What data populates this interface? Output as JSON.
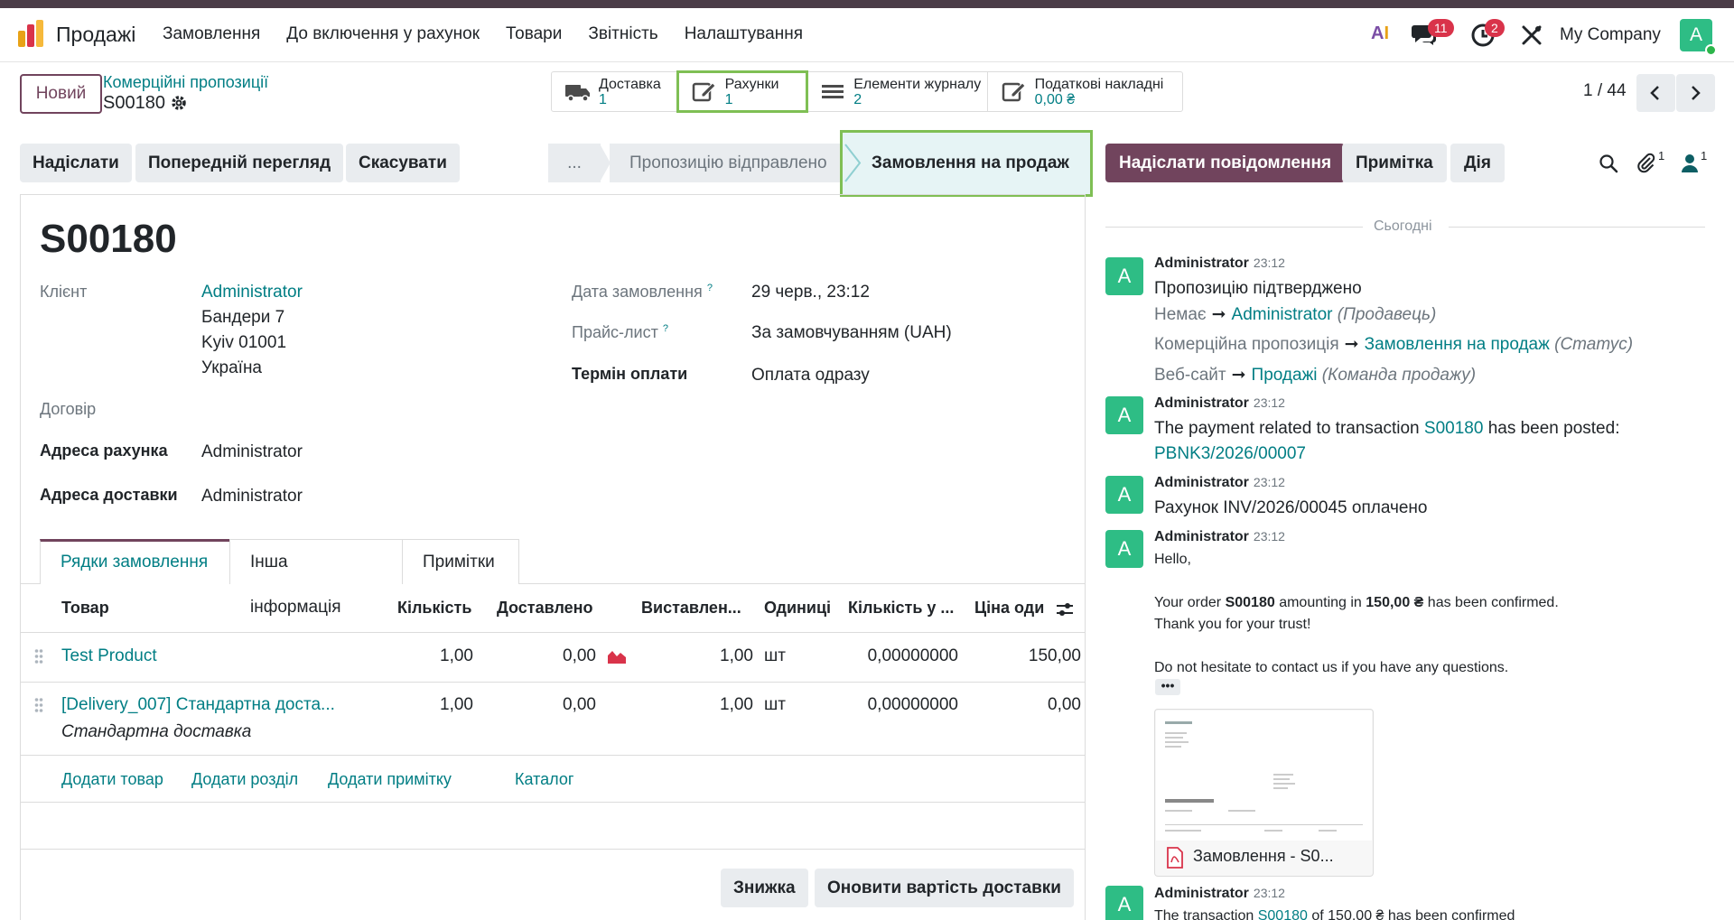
{
  "navbar": {
    "app_name": "Продажі",
    "menu": [
      "Замовлення",
      "До включення у рахунок",
      "Товари",
      "Звітність",
      "Налаштування"
    ],
    "ai_label_a": "A",
    "ai_label_i": "I",
    "messages_badge": "11",
    "activities_badge": "2",
    "company": "My Company",
    "user_initial": "A"
  },
  "control": {
    "new_button": "Новий",
    "breadcrumb_parent": "Комерційні пропозиції",
    "breadcrumb_current": "S00180",
    "smart_buttons": [
      {
        "title": "Доставка",
        "value": "1",
        "icon": "truck-icon"
      },
      {
        "title": "Рахунки",
        "value": "1",
        "icon": "pencil-square-icon"
      },
      {
        "title": "Елементи журналу",
        "value": "2",
        "icon": "list-icon"
      },
      {
        "title": "Податкові накладні",
        "value": "0,00 ₴",
        "icon": "pencil-square-icon"
      }
    ],
    "pager": "1 / 44"
  },
  "statusbar": {
    "buttons": [
      "Надіслати",
      "Попередній перегляд",
      "Скасувати"
    ],
    "stages": [
      "...",
      "Пропозицію відправлено",
      "Замовлення на продаж"
    ],
    "active_stage": "Замовлення на продаж"
  },
  "chatter_bar": {
    "send_message": "Надіслати повідомлення",
    "note": "Примітка",
    "action": "Дія",
    "attachments_count": "1",
    "followers_count": "1"
  },
  "form": {
    "name": "S00180",
    "customer_label": "Клієнт",
    "customer_name": "Administrator",
    "customer_address": [
      "Бандери 7",
      "Kyiv 01001",
      "Україна"
    ],
    "contract_label": "Договір",
    "invoice_address_label": "Адреса рахунка",
    "invoice_address": "Administrator",
    "delivery_address_label": "Адреса доставки",
    "delivery_address": "Administrator",
    "order_date_label": "Дата замовлення",
    "order_date": "29 черв., 23:12",
    "pricelist_label": "Прайс-лист",
    "pricelist": "За замовчуванням (UAH)",
    "payment_terms_label": "Термін оплати",
    "payment_terms": "Оплата одразу",
    "help_mark": "?"
  },
  "tabs": [
    "Рядки замовлення",
    "Інша інформація",
    "Примітки"
  ],
  "lines": {
    "headers": [
      "Товар",
      "Кількість",
      "Доставлено",
      "Виставлен...",
      "Одиниці",
      "Кількість у ...",
      "Ціна оди"
    ],
    "rows": [
      {
        "product": "Test Product",
        "qty": "1,00",
        "delivered": "0,00",
        "invoiced": "1,00",
        "uom": "шт",
        "packaging": "0,00000000",
        "price": "150,00",
        "description": ""
      },
      {
        "product": "[Delivery_007] Стандартна доста...",
        "qty": "1,00",
        "delivered": "0,00",
        "invoiced": "1,00",
        "uom": "шт",
        "packaging": "0,00000000",
        "price": "0,00",
        "description": "Стандартна доставка"
      }
    ],
    "add_links": [
      "Додати товар",
      "Додати розділ",
      "Додати примітку",
      "Каталог"
    ]
  },
  "footer_buttons": [
    "Знижка",
    "Оновити вартість доставки"
  ],
  "chatter": {
    "today": "Сьогодні",
    "messages": [
      {
        "author": "Administrator",
        "time": "23:12",
        "title": "Пропозицію підтверджено",
        "changes": [
          {
            "old": "Немає",
            "new": "Administrator",
            "field": "(Продавець)"
          },
          {
            "old": "Комерційна пропозиція",
            "new": "Замовлення на продаж",
            "field": "(Статус)"
          },
          {
            "old": "Веб-сайт",
            "new": "Продажі",
            "field": "(Команда продажу)"
          }
        ]
      },
      {
        "author": "Administrator",
        "time": "23:12",
        "text_before": "The payment related to transaction",
        "link1": "S00180",
        "text_after": "has been posted:",
        "link2": "PBNK3/2026/00007"
      },
      {
        "author": "Administrator",
        "time": "23:12",
        "text": "Рахунок INV/2026/00045 оплачено"
      },
      {
        "author": "Administrator",
        "time": "23:12",
        "hello": "Hello,",
        "line1_a": "Your order",
        "line1_b": "S00180",
        "line1_c": "amounting in",
        "line1_d": "150,00 ₴",
        "line1_e": "has been confirmed.",
        "line2": "Thank you for your trust!",
        "line3": "Do not hesitate to contact us if you have any questions.",
        "more": "•••",
        "attachment": "Замовлення - S0..."
      },
      {
        "author": "Administrator",
        "time": "23:12",
        "text_before": "The transaction",
        "link1": "S00180",
        "text_after": "of 150,00 ₴ has been confirmed"
      }
    ]
  },
  "colors": {
    "primary": "#71445d",
    "link": "#017e84",
    "avatar": "#2ebd85",
    "highlight": "#7fbf54"
  }
}
